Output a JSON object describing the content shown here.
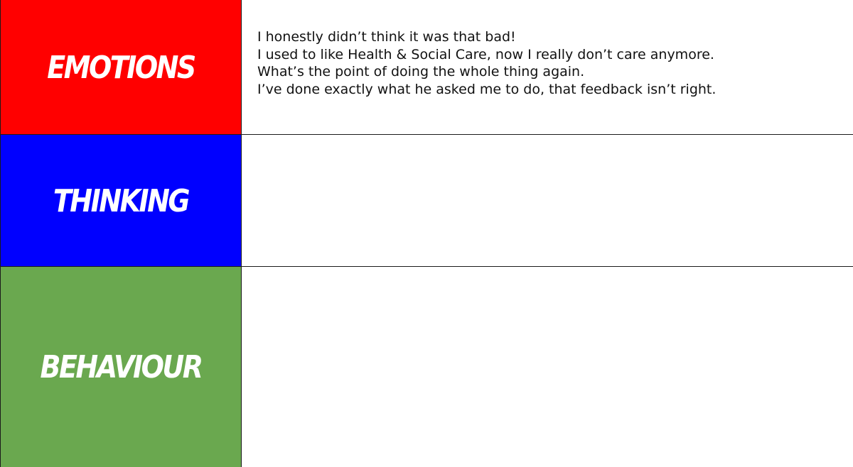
{
  "rows": {
    "emotions": {
      "label": "EMOTIONS",
      "color": "#ff0000",
      "lines": [
        "I honestly didn’t think it was that bad!",
        "I used to like Health & Social Care, now I really don’t care anymore.",
        "What’s the point of doing the whole thing again.",
        "I’ve done exactly what he asked me to do, that feedback isn’t right."
      ]
    },
    "thinking": {
      "label": "THINKING",
      "color": "#0000ff",
      "lines": []
    },
    "behaviour": {
      "label": "BEHAVIOUR",
      "color": "#6aa84f",
      "lines": []
    }
  }
}
